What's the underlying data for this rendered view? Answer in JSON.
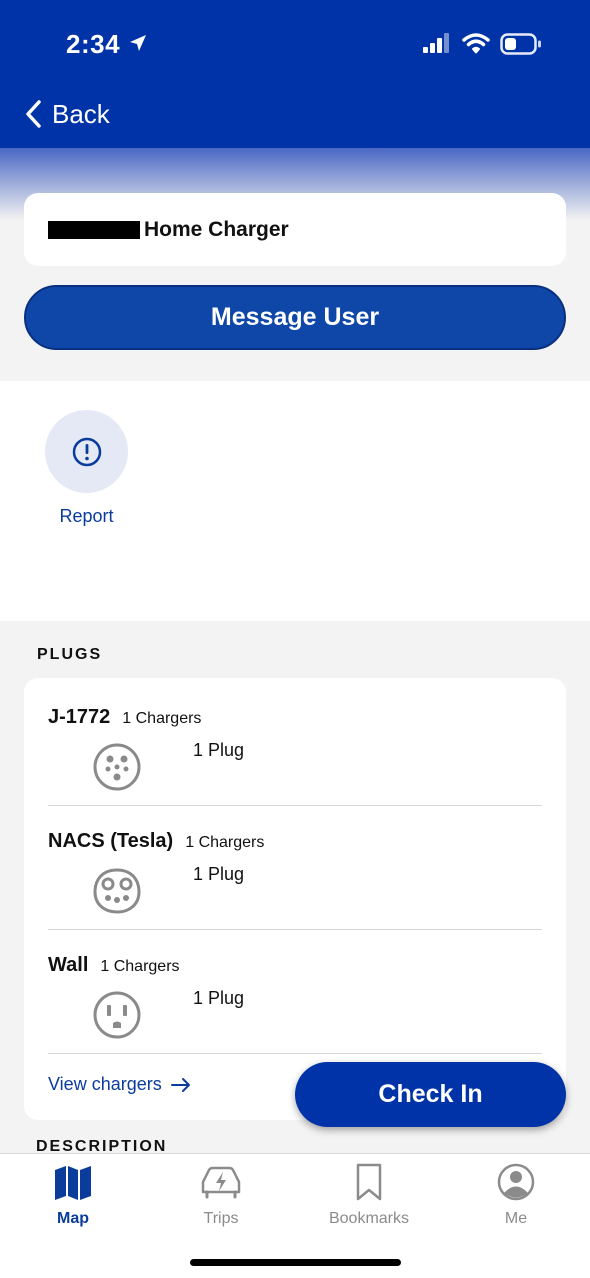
{
  "status_bar": {
    "time": "2:34"
  },
  "nav": {
    "back_label": "Back"
  },
  "charger": {
    "name": "Home Charger"
  },
  "message_button": "Message User",
  "report": {
    "label": "Report"
  },
  "plugs_section": {
    "title": "PLUGS",
    "items": [
      {
        "name": "J-1772",
        "chargers": "1 Chargers",
        "plugs": "1 Plug",
        "icon": "j1772-plug-icon"
      },
      {
        "name": "NACS (Tesla)",
        "chargers": "1 Chargers",
        "plugs": "1 Plug",
        "icon": "nacs-plug-icon"
      },
      {
        "name": "Wall",
        "chargers": "1 Chargers",
        "plugs": "1 Plug",
        "icon": "wall-outlet-icon"
      }
    ],
    "view_link": "View chargers"
  },
  "description_title": "DESCRIPTION",
  "checkin_button": "Check In",
  "tabs": [
    {
      "label": "Map",
      "icon": "map-icon",
      "active": true
    },
    {
      "label": "Trips",
      "icon": "car-charging-icon",
      "active": false
    },
    {
      "label": "Bookmarks",
      "icon": "bookmark-icon",
      "active": false
    },
    {
      "label": "Me",
      "icon": "profile-icon",
      "active": false
    }
  ],
  "colors": {
    "brand_blue": "#0033a8",
    "link_blue": "#0a3c9c",
    "inactive_gray": "#8b8b8b"
  }
}
